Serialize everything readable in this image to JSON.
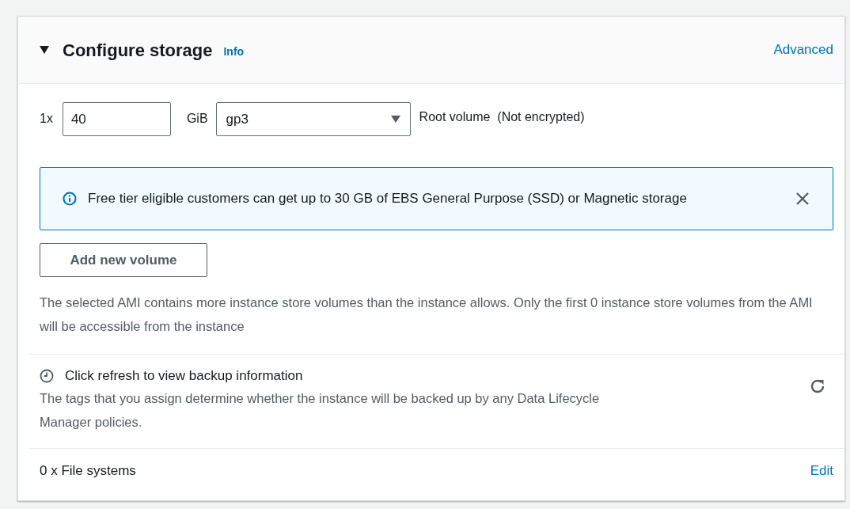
{
  "section": {
    "title": "Configure storage",
    "info_link": "Info",
    "advanced_link": "Advanced",
    "expanded": true
  },
  "volume": {
    "count": "1x",
    "size": "40",
    "unit": "GiB",
    "type": "gp3",
    "description": "Root volume",
    "encryption": "(Not encrypted)"
  },
  "alert": {
    "kind": "info",
    "message": "Free tier eligible customers can get up to 30 GB of EBS General Purpose (SSD) or Magnetic storage"
  },
  "add_button": "Add new volume",
  "note": "The selected AMI contains more instance store volumes than the instance allows. Only the first 0 instance store volumes from the AMI will be accessible from the instance",
  "backup": {
    "title": "Click refresh to view backup information",
    "description": "The tags that you assign determine whether the instance will be backed up by any Data Lifecycle Manager policies."
  },
  "file_systems": {
    "label": "0 x File systems",
    "edit_link": "Edit"
  }
}
